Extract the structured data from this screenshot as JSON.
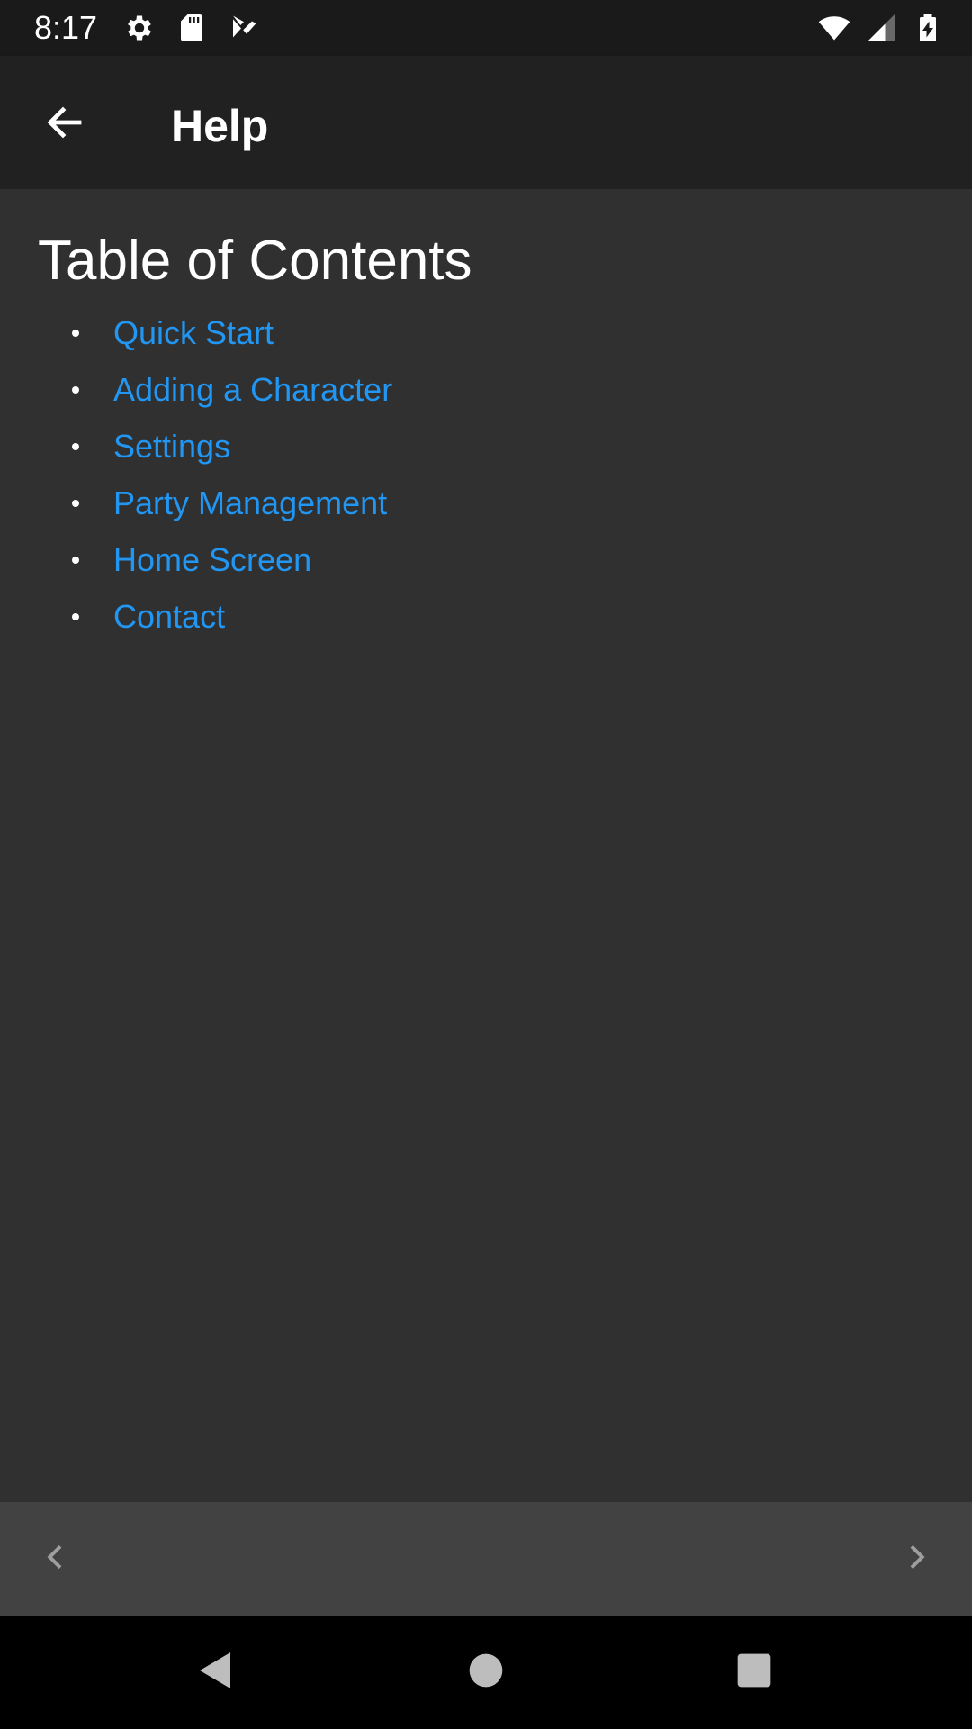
{
  "status_bar": {
    "time": "8:17",
    "left_icons": [
      "gear-icon",
      "sd-card-icon",
      "play-store-icon"
    ],
    "right_icons": [
      "wifi-icon",
      "cell-signal-icon",
      "battery-charging-icon"
    ]
  },
  "app_bar": {
    "title": "Help",
    "back_icon": "arrow-left-icon"
  },
  "content": {
    "heading": "Table of Contents",
    "items": [
      {
        "label": "Quick Start"
      },
      {
        "label": "Adding a Character"
      },
      {
        "label": "Settings"
      },
      {
        "label": "Party Management"
      },
      {
        "label": "Home Screen"
      },
      {
        "label": "Contact"
      }
    ]
  },
  "bottom_bar": {
    "prev_icon": "chevron-left-icon",
    "next_icon": "chevron-right-icon"
  },
  "system_nav": {
    "buttons": [
      "triangle-back-icon",
      "circle-home-icon",
      "square-recents-icon"
    ]
  },
  "colors": {
    "background": "#303030",
    "app_bar": "#212121",
    "status_bar": "#1a1a1a",
    "bottom_bar": "#424242",
    "link": "#2196f3",
    "text": "#ffffff"
  }
}
